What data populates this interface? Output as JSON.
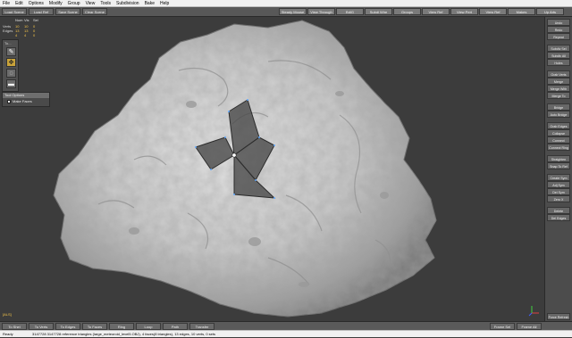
{
  "menu": [
    "File",
    "Edit",
    "Options",
    "Modify",
    "Group",
    "View",
    "Tools",
    "Subdivision",
    "Bake",
    "Help"
  ],
  "toolbar": {
    "left": [
      "Load Scene",
      "Load Ref",
      "Save Scene",
      "Clear Scene"
    ],
    "right": [
      "Steady Mouse",
      "View Through",
      "BdiG",
      "Subdl Wire",
      "Groups",
      "View Ref",
      "View Pert",
      "View Ref",
      "Makes",
      "Up Arts"
    ]
  },
  "stats": {
    "headers": [
      "Num",
      "Vis",
      "Sel"
    ],
    "rows": [
      {
        "label": "Verts",
        "num": "10",
        "vis": "10",
        "sel": "0"
      },
      {
        "label": "Edges",
        "num": "13",
        "vis": "13",
        "sel": "0"
      },
      {
        "label": "",
        "num": "4",
        "vis": "4",
        "sel": "0"
      }
    ]
  },
  "tool_panel": {
    "title": "To..."
  },
  "tool_options": {
    "title": "Tool Options",
    "checkbox_label": "Make Faces",
    "checked": false
  },
  "right_panel": {
    "groups": [
      [
        "Undo",
        "Redo",
        "Repeat"
      ],
      [
        "Subdiv Sel",
        "Subdiv All",
        "Holes"
      ],
      [
        "Grab Verts",
        "Merge",
        "Merge With",
        "Merge To"
      ],
      [
        "Bridge",
        "Auto Bridge"
      ],
      [
        "Grab Edges",
        "Collapse",
        "Connect",
        "Connect Ring"
      ],
      [
        "Straighten",
        "Snap To Ref"
      ],
      [
        "Create Sym",
        "Adj Sym",
        "Del Sym",
        "Zero X"
      ],
      [
        "Delete",
        "Del Edges"
      ]
    ],
    "refresh": "Force Refresh"
  },
  "bottom": {
    "left": [
      "To Shel",
      "To Verts",
      "To Edges",
      "To Faces",
      "Ring",
      "Loop",
      "Path",
      "Transfer"
    ],
    "right": [
      "Frame Sel",
      "Frame All"
    ]
  },
  "status": {
    "ready": "Ready",
    "message": "3147728 3147728 reference triangles (large_meteoroid_level5.OBJ), 4 faces(8 triangles), 13 edges, 10 verts, 0 sets"
  },
  "fps": "[ALS]",
  "colors": {
    "accent": "#f7c64a",
    "model": "#c8c8c8",
    "background": "#3c3c3c"
  }
}
